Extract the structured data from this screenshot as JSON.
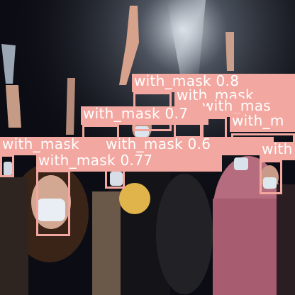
{
  "image": {
    "description_colors": {
      "background": "#0b0b10",
      "detection": "#f2a7a0"
    }
  },
  "detections": [
    {
      "label": "with_mask",
      "score": "0.8"
    },
    {
      "label": "with_mask",
      "score": ""
    },
    {
      "label": "with_mas",
      "score": ""
    },
    {
      "label": "with_mask",
      "score": "0.7"
    },
    {
      "label": "with_m",
      "score": ""
    },
    {
      "label": "with_mask",
      "score": ""
    },
    {
      "label": "with_mask",
      "score": "0.6"
    },
    {
      "label": "with",
      "score": ""
    },
    {
      "label": "with_mask",
      "score": "0.77"
    }
  ]
}
